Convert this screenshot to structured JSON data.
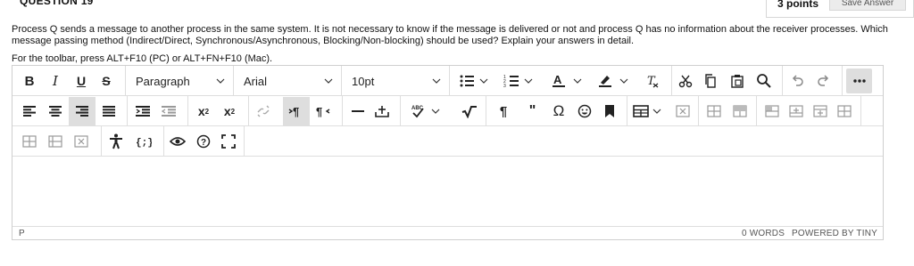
{
  "question": {
    "title": "QUESTION 19",
    "points": "3 points",
    "save_label": "Save Answer",
    "text": "Process Q sends a message to another process in the same system. It is not necessary to know if the message is delivered or not and process Q has no information about the receiver processes. Which message passing method (Indirect/Direct, Synchronous/Asynchronous, Blocking/Non-blocking) should be used? Explain your answers in detail.",
    "toolbar_hint": "For the toolbar, press ALT+F10 (PC) or ALT+FN+F10 (Mac)."
  },
  "toolbar": {
    "block_format": "Paragraph",
    "font_family": "Arial",
    "font_size": "10pt"
  },
  "status_bar": {
    "path": "P",
    "word_count": "0 WORDS",
    "powered_by": "POWERED BY TINY"
  }
}
